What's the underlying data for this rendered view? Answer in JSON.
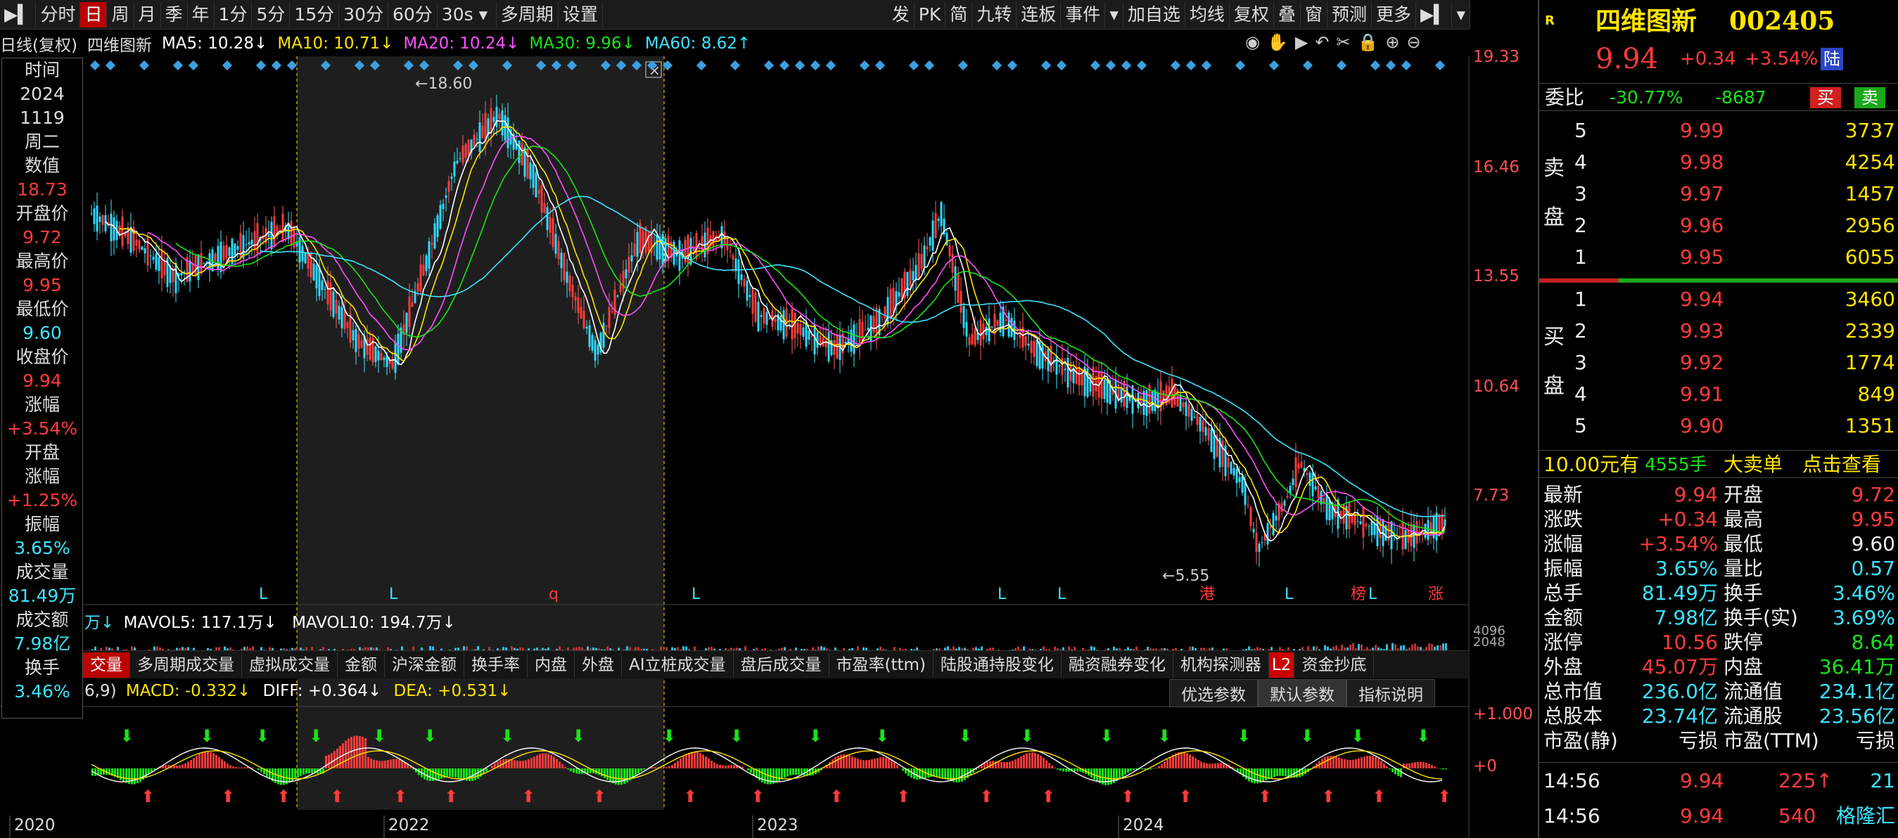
{
  "toolbar": {
    "left": [
      "分时",
      "日",
      "周",
      "月",
      "季",
      "年",
      "1分",
      "5分",
      "15分",
      "30分",
      "60分",
      "30s",
      "多周期",
      "设置"
    ],
    "active": "日",
    "right": [
      "发",
      "PK",
      "简",
      "九转",
      "连板",
      "事件",
      "加自选",
      "均线",
      "复权",
      "叠",
      "窗",
      "预测",
      "更多"
    ]
  },
  "ma_line": {
    "period": "日线(复权)",
    "name": "四维图新",
    "ma5": "MA5: 10.28↓",
    "ma10": "MA10: 10.71↓",
    "ma20": "MA20: 10.24↓",
    "ma30": "MA30: 9.96↓",
    "ma60": "MA60: 8.62↑"
  },
  "price_axis": [
    "19.33",
    "16.46",
    "13.55",
    "10.64",
    "7.73"
  ],
  "annotations": {
    "high": "18.60",
    "low": "5.55"
  },
  "signals": [
    "L",
    "L",
    "q",
    "L",
    "L",
    "L",
    "L",
    "L",
    "L",
    "榜",
    "港",
    "涨"
  ],
  "left_panel": {
    "rows": [
      {
        "k": "时间",
        "v": ""
      },
      {
        "k": "2024",
        "v": ""
      },
      {
        "k": "1119",
        "v": ""
      },
      {
        "k": "周二",
        "v": ""
      },
      {
        "k": "数值",
        "v": "18.73"
      },
      {
        "k": "开盘价",
        "v": "9.72"
      },
      {
        "k": "最高价",
        "v": "9.95"
      },
      {
        "k": "最低价",
        "v": "9.60"
      },
      {
        "k": "收盘价",
        "v": "9.94"
      },
      {
        "k": "涨幅",
        "v": "+3.54%"
      },
      {
        "k": "开盘",
        "v": ""
      },
      {
        "k": "涨幅",
        "v": "+1.25%"
      },
      {
        "k": "振幅",
        "v": "3.65%"
      },
      {
        "k": "成交量",
        "v": "81.49万"
      },
      {
        "k": "成交额",
        "v": "7.98亿"
      },
      {
        "k": "换手",
        "v": "3.46%"
      }
    ]
  },
  "vol_line": {
    "a": "万↓",
    "mavol5": "MAVOL5: 117.1万↓",
    "mavol10": "MAVOL10: 194.7万↓",
    "vaxis": [
      "4096",
      "2048"
    ]
  },
  "tabs": [
    "交量",
    "多周期成交量",
    "虚拟成交量",
    "金额",
    "沪深金额",
    "换手率",
    "内盘",
    "外盘",
    "AI立桩成交量",
    "盘后成交量",
    "市盈率(ttm)",
    "陆股通持股变化",
    "融资融券变化",
    "机构探测器",
    "L2",
    "资金抄底"
  ],
  "macd_line": {
    "a": "6,9)",
    "macd": "MACD: -0.332↓",
    "diff": "DIFF: +0.364↓",
    "dea": "DEA: +0.531↓",
    "btns": [
      "优选参数",
      "默认参数",
      "指标说明"
    ],
    "axis": [
      "+1.000",
      "+0"
    ]
  },
  "years": [
    "2020",
    "2022",
    "2023",
    "2024"
  ],
  "quote": {
    "name": "四维图新",
    "code": "002405",
    "price": "9.94",
    "change": "+0.34",
    "pct": "+3.54%",
    "tag": "陆",
    "weibi_label": "委比",
    "weibi": "-30.77%",
    "weicha": "-8687",
    "buy": "买",
    "sell": "卖",
    "asks": [
      {
        "n": "5",
        "p": "9.99",
        "v": "3737"
      },
      {
        "n": "4",
        "p": "9.98",
        "v": "4254"
      },
      {
        "n": "3",
        "p": "9.97",
        "v": "1457"
      },
      {
        "n": "2",
        "p": "9.96",
        "v": "2956"
      },
      {
        "n": "1",
        "p": "9.95",
        "v": "6055"
      }
    ],
    "bids": [
      {
        "n": "1",
        "p": "9.94",
        "v": "3460"
      },
      {
        "n": "2",
        "p": "9.93",
        "v": "2339"
      },
      {
        "n": "3",
        "p": "9.92",
        "v": "1774"
      },
      {
        "n": "4",
        "p": "9.91",
        "v": "849"
      },
      {
        "n": "5",
        "p": "9.90",
        "v": "1351"
      }
    ],
    "ask_label": [
      "卖",
      "盘"
    ],
    "bid_label": [
      "买",
      "盘"
    ],
    "bigorder": {
      "price": "10.00元有",
      "qty": "4555手",
      "label": "大卖单",
      "link": "点击查看"
    },
    "stats": [
      {
        "k1": "最新",
        "v1": "9.94",
        "c1": "red",
        "k2": "开盘",
        "v2": "9.72",
        "c2": "red"
      },
      {
        "k1": "涨跌",
        "v1": "+0.34",
        "c1": "red",
        "k2": "最高",
        "v2": "9.95",
        "c2": "red"
      },
      {
        "k1": "涨幅",
        "v1": "+3.54%",
        "c1": "red",
        "k2": "最低",
        "v2": "9.60",
        "c2": "white"
      },
      {
        "k1": "振幅",
        "v1": "3.65%",
        "c1": "cyan",
        "k2": "量比",
        "v2": "0.57",
        "c2": "cyan"
      },
      {
        "k1": "总手",
        "v1": "81.49万",
        "c1": "cyan",
        "k2": "换手",
        "v2": "3.46%",
        "c2": "cyan"
      },
      {
        "k1": "金额",
        "v1": "7.98亿",
        "c1": "cyan",
        "k2": "换手(实)",
        "v2": "3.69%",
        "c2": "cyan"
      },
      {
        "k1": "涨停",
        "v1": "10.56",
        "c1": "red",
        "k2": "跌停",
        "v2": "8.64",
        "c2": "green"
      },
      {
        "k1": "外盘",
        "v1": "45.07万",
        "c1": "red",
        "k2": "内盘",
        "v2": "36.41万",
        "c2": "green"
      },
      {
        "k1": "总市值",
        "v1": "236.0亿",
        "c1": "cyan",
        "k2": "流通值",
        "v2": "234.1亿",
        "c2": "cyan"
      },
      {
        "k1": "总股本",
        "v1": "23.74亿",
        "c1": "cyan",
        "k2": "流通股",
        "v2": "23.56亿",
        "c2": "cyan"
      },
      {
        "k1": "市盈(静)",
        "v1": "亏损",
        "c1": "white",
        "k2": "市盈(TTM)",
        "v2": "亏损",
        "c2": "white"
      }
    ],
    "ticks": [
      {
        "t": "14:56",
        "p": "9.94",
        "v": "225↑",
        "n": "21"
      },
      {
        "t": "14:56",
        "p": "9.94",
        "v": "540",
        "n": "格隆汇"
      }
    ]
  },
  "colors": {
    "up": "#ff3b3b",
    "down": "#19e319",
    "ma5": "#ffffff",
    "ma10": "#ffe500",
    "ma20": "#ff50ff",
    "ma30": "#19e319",
    "ma60": "#3de3ff"
  }
}
